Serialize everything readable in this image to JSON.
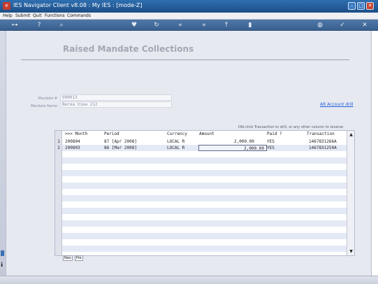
{
  "window": {
    "title": "IES Navigator Client v8.08 : My IES :      [mode-Z]",
    "app_icon": "ies-logo-icon",
    "minimize": "–",
    "maximize": "□",
    "close": "✕"
  },
  "menubar": {
    "items": [
      "Help",
      "Submit",
      "Quit",
      "Functions",
      "Commands"
    ]
  },
  "toolbar": {
    "icons": [
      "key-icon",
      "help-icon",
      "search-icon",
      "heart-icon",
      "refresh-icon",
      "rewind-icon",
      "fast-forward-icon",
      "upload-icon",
      "columns-icon",
      "globe-icon",
      "check-icon",
      "close-icon"
    ]
  },
  "page": {
    "title": "Raised Mandate Collections"
  },
  "form": {
    "mandate_label": "Mandate #",
    "mandate_value": "000013",
    "mandate_name_label": "Mandate Name",
    "mandate_name_value": "Berea View 212"
  },
  "links": {
    "ar_account": "AR Account drill"
  },
  "hint": {
    "text": "Dbl-click Transaction to drill,    or any other column to reverse"
  },
  "grid": {
    "columns": [
      ">>> Month",
      "Period",
      "Currency",
      "Amount",
      "Paid ?",
      "Transaction"
    ],
    "rows": [
      {
        "num": "1",
        "month": "200804",
        "period": "87  [Apr 2008]",
        "currency": "LOCAL R",
        "amount": "2,000.00",
        "paid": "YES",
        "transaction": "1467831266A"
      },
      {
        "num": "2",
        "month": "200803",
        "period": "86  [Mar 2008]",
        "currency": "LOCAL R",
        "amount": "2,000.00",
        "paid": "YES",
        "transaction": "1467831250A"
      }
    ],
    "scroll_up": "▲",
    "scroll_down": "▼"
  },
  "bottom_tabs": [
    "Nex",
    "Pre"
  ],
  "colors": {
    "title_bar": "#2f6fb0",
    "toolbar": "#4f78a8",
    "row_band": "#e4eaf5",
    "link": "#1f5fd6"
  }
}
